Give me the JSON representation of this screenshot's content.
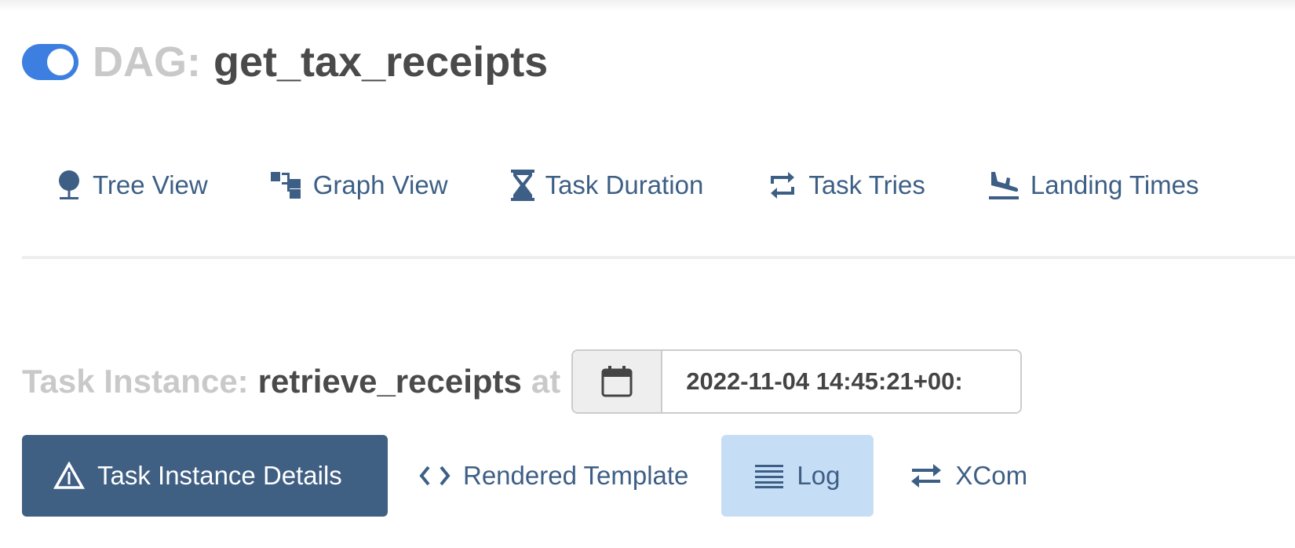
{
  "dag": {
    "prefix": "DAG:",
    "name": "get_tax_receipts",
    "toggle_on": true
  },
  "views": [
    {
      "label": "Tree View",
      "icon": "tree-icon"
    },
    {
      "label": "Graph View",
      "icon": "graph-icon"
    },
    {
      "label": "Task Duration",
      "icon": "hourglass-icon"
    },
    {
      "label": "Task Tries",
      "icon": "retweet-icon"
    },
    {
      "label": "Landing Times",
      "icon": "plane-landing-icon"
    }
  ],
  "task_instance": {
    "prefix": "Task Instance:",
    "name": "retrieve_receipts",
    "at": "at",
    "execution_date": "2022-11-04 14:45:21+00:"
  },
  "tabs": [
    {
      "label": "Task Instance Details",
      "icon": "warning-icon",
      "active": true
    },
    {
      "label": "Rendered Template",
      "icon": "code-icon"
    },
    {
      "label": "Log",
      "icon": "list-icon",
      "highlighted": true
    },
    {
      "label": "XCom",
      "icon": "exchange-icon"
    }
  ],
  "colors": {
    "toggle": "#3d7fe0",
    "link": "#3d5f85",
    "active_tab": "#3f5f83",
    "highlight_tab": "#c6ddf6",
    "muted_text": "#c9c9c9",
    "dark_text": "#4a4a4a"
  }
}
